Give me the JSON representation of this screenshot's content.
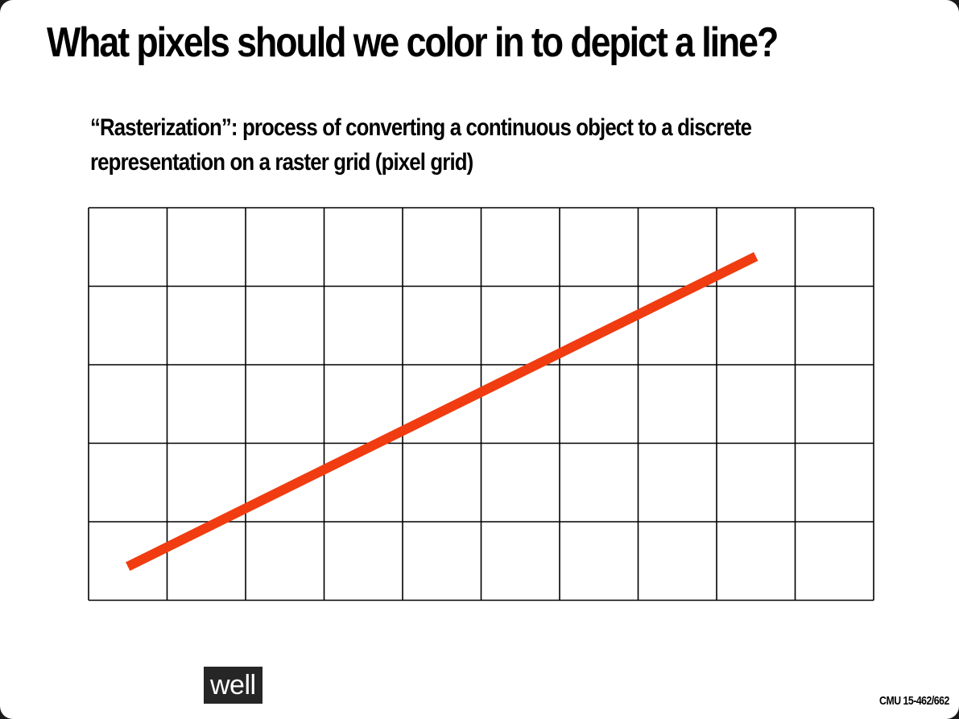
{
  "slide": {
    "title": "What pixels should we color in to depict a line?",
    "subtitle_line1": "“Rasterization”: process of converting a continuous object to a discrete",
    "subtitle_line2": "representation on a raster grid (pixel grid)",
    "footer": "CMU 15-462/662"
  },
  "grid": {
    "columns": 10,
    "rows": 5
  },
  "line": {
    "color": "#f03c10",
    "start": [
      0.5,
      0.43
    ],
    "end": [
      8.5,
      4.38
    ]
  },
  "caption": {
    "text": "well"
  }
}
